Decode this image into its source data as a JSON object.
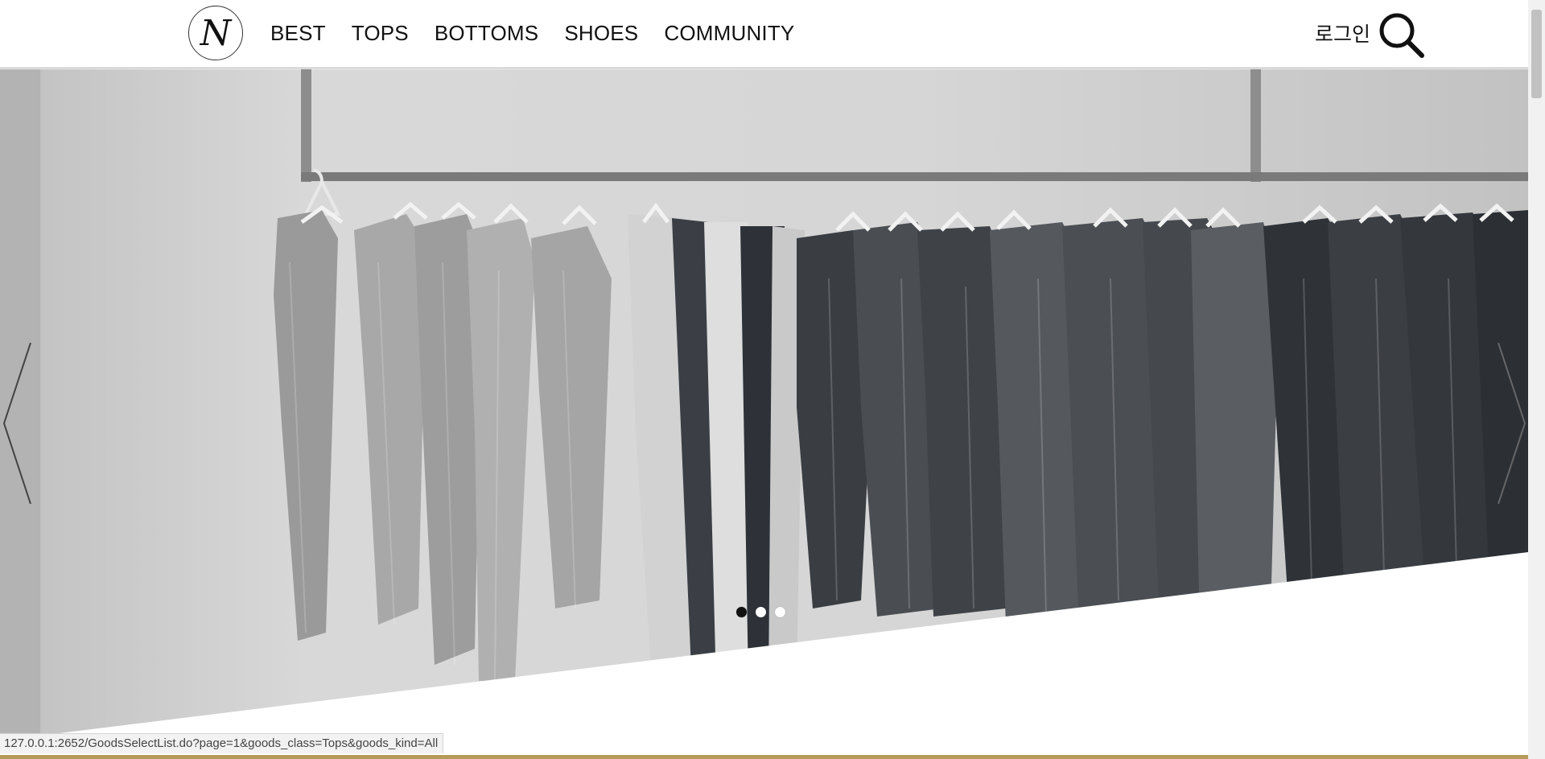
{
  "header": {
    "logo_letter": "N",
    "nav": [
      "BEST",
      "TOPS",
      "BOTTOMS",
      "SHOES",
      "COMMUNITY"
    ],
    "login_label": "로그인",
    "search_icon": "search-icon"
  },
  "hero": {
    "image": "clothes-rack-photo",
    "slide_count": 3,
    "active_slide": 1,
    "prev_icon": "chevron-left-icon",
    "next_icon": "chevron-right-icon"
  },
  "status_bar": {
    "url": "127.0.0.1:2652/GoodsSelectList.do?page=1&goods_class=Tops&goods_kind=All"
  },
  "colors": {
    "accent_line": "#b49b5a",
    "text": "#111111"
  }
}
